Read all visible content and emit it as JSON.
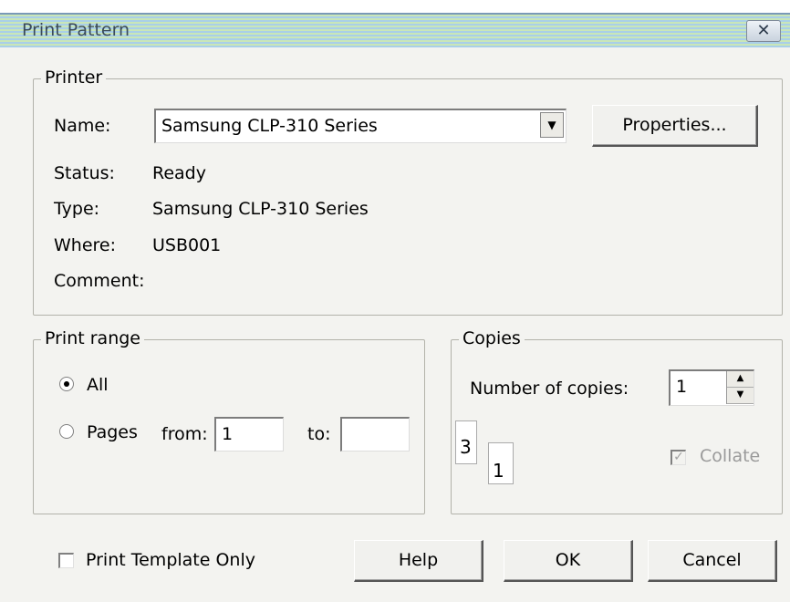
{
  "window": {
    "title": "Print Pattern",
    "close_glyph": "✕"
  },
  "printer": {
    "group_label": "Printer",
    "name_label": "Name:",
    "name_value": "Samsung CLP-310 Series",
    "properties_button": "Properties...",
    "status_label": "Status:",
    "status_value": "Ready",
    "type_label": "Type:",
    "type_value": "Samsung CLP-310 Series",
    "where_label": "Where:",
    "where_value": "USB001",
    "comment_label": "Comment:",
    "comment_value": ""
  },
  "print_range": {
    "group_label": "Print range",
    "all_label": "All",
    "pages_label": "Pages",
    "from_label": "from:",
    "from_value": "1",
    "to_label": "to:",
    "to_value": "",
    "selected": "All"
  },
  "copies": {
    "group_label": "Copies",
    "number_label": "Number of copies:",
    "number_value": "1",
    "collate_label": "Collate",
    "collate_checked": true,
    "collate_enabled": false,
    "page_back": "3",
    "page_front": "1"
  },
  "footer": {
    "template_only_label": "Print Template Only",
    "template_only_checked": false,
    "help_button": "Help",
    "ok_button": "OK",
    "cancel_button": "Cancel"
  }
}
